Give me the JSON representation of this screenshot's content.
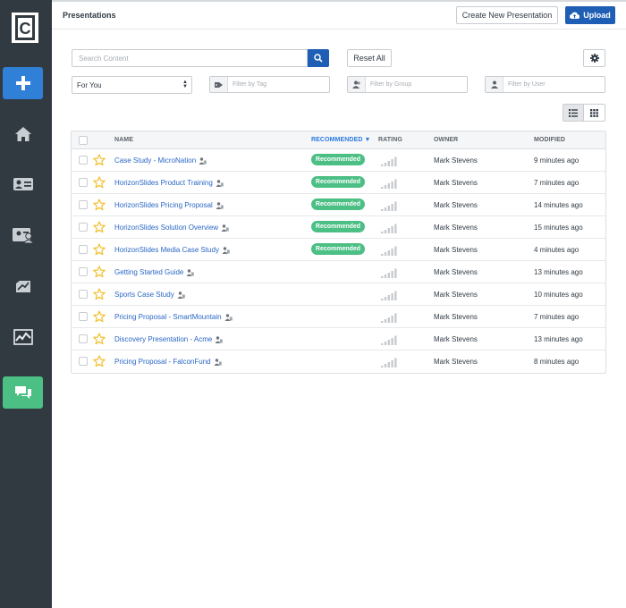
{
  "app": {
    "logo_letter": "C"
  },
  "header": {
    "title": "Presentations",
    "create_label": "Create New Presentation",
    "upload_label": "Upload"
  },
  "sidebar": {
    "items": [
      {
        "name": "add",
        "icon": "plus-icon"
      },
      {
        "name": "home",
        "icon": "home-icon"
      },
      {
        "name": "contacts",
        "icon": "contact-card-icon"
      },
      {
        "name": "profiles",
        "icon": "profile-card-icon"
      },
      {
        "name": "reports",
        "icon": "trending-icon"
      },
      {
        "name": "analytics",
        "icon": "line-chart-icon"
      },
      {
        "name": "presentations",
        "icon": "chat-bubbles-icon"
      }
    ]
  },
  "filters": {
    "search_placeholder": "Search Content",
    "reset_label": "Reset All",
    "view_selected": "For You",
    "tag_placeholder": "Filter by Tag",
    "group_placeholder": "Filter by Group",
    "user_placeholder": "Filter by User"
  },
  "table": {
    "columns": {
      "name": "NAME",
      "recommended": "RECOMMENDED",
      "rating": "RATING",
      "owner": "OWNER",
      "modified": "MODIFIED"
    },
    "recommended_badge": "Recommended",
    "rows": [
      {
        "name": "Case Study - MicroNation",
        "recommended": true,
        "owner": "Mark Stevens",
        "modified": "9 minutes ago"
      },
      {
        "name": "HorizonSlides Product Training",
        "recommended": true,
        "owner": "Mark Stevens",
        "modified": "7 minutes ago"
      },
      {
        "name": "HorizonSlides Pricing Proposal",
        "recommended": true,
        "owner": "Mark Stevens",
        "modified": "14 minutes ago"
      },
      {
        "name": "HorizonSlides Solution Overview",
        "recommended": true,
        "owner": "Mark Stevens",
        "modified": "15 minutes ago"
      },
      {
        "name": "HorizonSlides Media Case Study",
        "recommended": true,
        "owner": "Mark Stevens",
        "modified": "4 minutes ago"
      },
      {
        "name": "Getting Started Guide",
        "recommended": false,
        "owner": "Mark Stevens",
        "modified": "13 minutes ago"
      },
      {
        "name": "Sports Case Study",
        "recommended": false,
        "owner": "Mark Stevens",
        "modified": "10 minutes ago"
      },
      {
        "name": "Pricing Proposal - SmartMountain",
        "recommended": false,
        "owner": "Mark Stevens",
        "modified": "7 minutes ago"
      },
      {
        "name": "Discovery Presentation - Acme",
        "recommended": false,
        "owner": "Mark Stevens",
        "modified": "13 minutes ago"
      },
      {
        "name": "Pricing Proposal - FalconFund",
        "recommended": false,
        "owner": "Mark Stevens",
        "modified": "8 minutes ago"
      }
    ]
  },
  "colors": {
    "sidebar_bg": "#323a41",
    "add_button": "#2f80d6",
    "active_nav": "#4cbf85",
    "primary": "#1e5eb4",
    "link": "#2a67c5",
    "badge": "#4cbf85",
    "star": "#f2c02e"
  }
}
